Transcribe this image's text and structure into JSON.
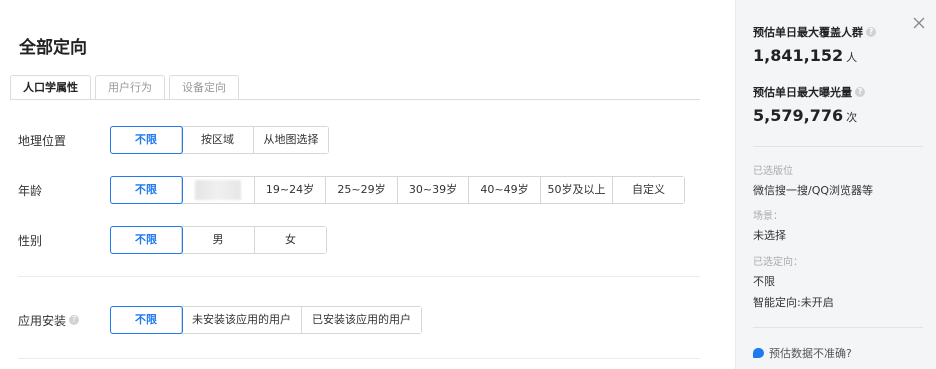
{
  "page": {
    "title": "全部定向",
    "tabs": [
      {
        "label": "人口学属性",
        "active": true
      },
      {
        "label": "用户行为",
        "active": false
      },
      {
        "label": "设备定向",
        "active": false
      }
    ]
  },
  "rows": {
    "location": {
      "label": "地理位置",
      "options": [
        "不限",
        "按区域",
        "从地图选择"
      ],
      "selected": "不限"
    },
    "age": {
      "label": "年龄",
      "options": [
        "不限",
        "",
        "19~24岁",
        "25~29岁",
        "30~39岁",
        "40~49岁",
        "50岁及以上",
        "自定义"
      ],
      "selected": "不限"
    },
    "gender": {
      "label": "性别",
      "options": [
        "不限",
        "男",
        "女"
      ],
      "selected": "不限"
    },
    "app_install": {
      "label": "应用安装",
      "options": [
        "不限",
        "未安装该应用的用户",
        "已安装该应用的用户"
      ],
      "selected": "不限"
    }
  },
  "sidebar": {
    "max_coverage": {
      "heading": "预估单日最大覆盖人群",
      "value": "1,841,152",
      "unit": "人"
    },
    "max_exposure": {
      "heading": "预估单日最大曝光量",
      "value": "5,579,776",
      "unit": "次"
    },
    "placement_label": "已选版位",
    "placement_value": "微信搜一搜/QQ浏览器等",
    "scene_label": "场景：",
    "scene_value": "未选择",
    "targeting_label": "已选定向：",
    "targeting_value": "不限",
    "smart_targeting": "智能定向:未开启",
    "feedback_link": "预估数据不准确?"
  },
  "icons": {
    "help": "question-circle-icon",
    "close": "close-icon",
    "feedback": "chat-bubble-icon"
  },
  "colors": {
    "accent": "#1f7af0",
    "sidebar_bg": "#f4f5f6"
  }
}
